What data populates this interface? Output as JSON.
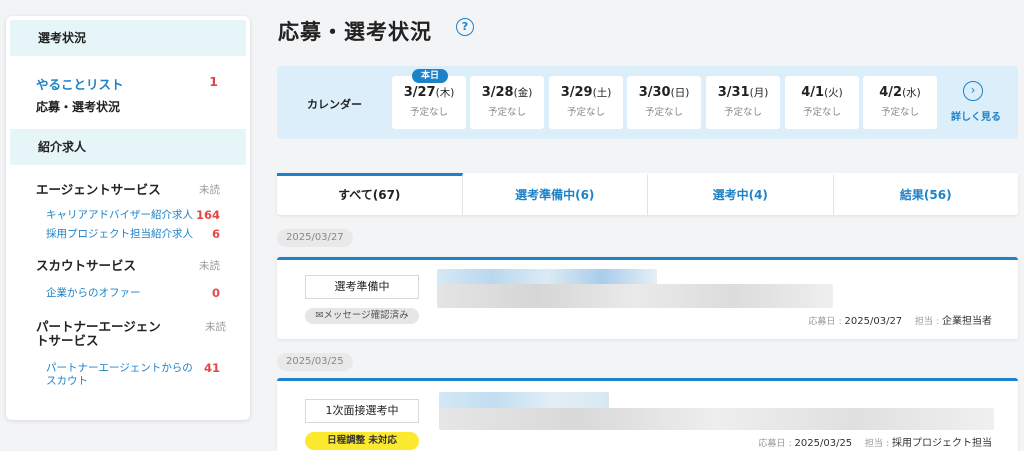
{
  "sidebar": {
    "section1": "選考状況",
    "todo": {
      "label": "やることリスト",
      "count": "1"
    },
    "status_link": "応募・選考状況",
    "section2": "紹介求人",
    "groups": [
      {
        "title": "エージェントサービス",
        "unread": "未読",
        "items": [
          {
            "label": "キャリアアドバイザー紹介求人",
            "count": "164"
          },
          {
            "label": "採用プロジェクト担当紹介求人",
            "count": "6"
          }
        ]
      },
      {
        "title": "スカウトサービス",
        "unread": "未読",
        "items": [
          {
            "label": "企業からのオファー",
            "count": "0"
          }
        ]
      },
      {
        "title": "パートナーエージェントサービス",
        "unread": "未読",
        "items": [
          {
            "label": "パートナーエージェントからのスカウト",
            "count": "41"
          }
        ]
      }
    ]
  },
  "main": {
    "title": "応募・選考状況",
    "help_glyph": "?"
  },
  "calendar": {
    "label": "カレンダー",
    "today_badge": "本日",
    "days": [
      {
        "date": "3/27",
        "dow": "(木)",
        "schedule": "予定なし"
      },
      {
        "date": "3/28",
        "dow": "(金)",
        "schedule": "予定なし"
      },
      {
        "date": "3/29",
        "dow": "(土)",
        "schedule": "予定なし"
      },
      {
        "date": "3/30",
        "dow": "(日)",
        "schedule": "予定なし"
      },
      {
        "date": "3/31",
        "dow": "(月)",
        "schedule": "予定なし"
      },
      {
        "date": "4/1",
        "dow": "(火)",
        "schedule": "予定なし"
      },
      {
        "date": "4/2",
        "dow": "(水)",
        "schedule": "予定なし"
      }
    ],
    "more_label": "詳しく見る",
    "more_icon": "chevron-right-circle-icon"
  },
  "tabs": [
    {
      "label": "すべて(67)",
      "active": true
    },
    {
      "label": "選考準備中(6)"
    },
    {
      "label": "選考中(4)"
    },
    {
      "label": "結果(56)"
    }
  ],
  "entries": [
    {
      "date": "2025/03/27",
      "status": "選考準備中",
      "badge": "メッセージ確認済み",
      "badge_icon": "envelope-icon",
      "applied_label": "応募日",
      "applied_date": "2025/03/27",
      "owner_label": "担当",
      "owner": "企業担当者"
    },
    {
      "date": "2025/03/25",
      "status": "1次面接選考中",
      "badge": "日程調整 未対応",
      "applied_label": "応募日",
      "applied_date": "2025/03/25",
      "owner_label": "担当",
      "owner": "採用プロジェクト担当"
    }
  ],
  "colors": {
    "accent": "#1d82c8",
    "count_red": "#e64545",
    "badge_yellow": "#fde830"
  }
}
